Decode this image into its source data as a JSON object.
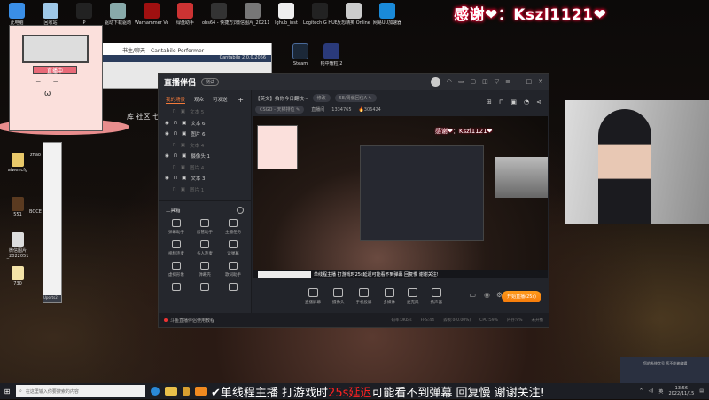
{
  "desktop": {
    "icons_top": [
      {
        "label": "此电脑",
        "color": "#3a8ee6"
      },
      {
        "label": "回收站",
        "color": "#9ec8e8"
      },
      {
        "label": "P",
        "color": "#222"
      },
      {
        "label": "驱动下载驱动",
        "color": "#8aa"
      },
      {
        "label": "Warhammer Vermintide",
        "color": "#a01010"
      },
      {
        "label": "绿盘助手",
        "color": "#c33"
      },
      {
        "label": "obs64 - 快捷方式",
        "color": "#333"
      },
      {
        "label": "微信图片_2021111",
        "color": "#777"
      },
      {
        "label": "lghub_inst",
        "color": "#eee"
      },
      {
        "label": "Logitech G HUB",
        "color": "#222"
      },
      {
        "label": "反恐精英 Online",
        "color": "#ccc"
      },
      {
        "label": "网易UU加速器",
        "color": "#1a8ad8"
      }
    ],
    "icons_second_row": [
      {
        "label": "Steam",
        "color": "#1b2838"
      },
      {
        "label": "帕中耀粒 2",
        "color": "#2a3a7a"
      }
    ],
    "icons_left": [
      {
        "label": "aiwencfg"
      },
      {
        "label": "zhao"
      },
      {
        "label": "551"
      },
      {
        "label": "BOCE"
      },
      {
        "label": "微信图片_2022051"
      },
      {
        "label": "730"
      }
    ],
    "left_window_footer": "Uports2",
    "partial_text": "库 社区 七"
  },
  "overlay": {
    "thanks": "感谢❤：Kszl1121❤",
    "pink_widget_tag": "直播中"
  },
  "cantabile": {
    "title": "书生/聊天 - Cantabile Performer",
    "version": "Cantabile 2.0.0.2066"
  },
  "app": {
    "logo": "直播伴侣",
    "version_badge": "测试",
    "title_icons": [
      "headset-icon",
      "message-icon",
      "screen-icon",
      "layers-icon",
      "shirt-icon",
      "menu-icon",
      "minimize-icon",
      "maximize-icon",
      "close-icon"
    ],
    "sidebar": {
      "tabs": [
        "我的场景",
        "观众",
        "可发送"
      ],
      "add": "+",
      "sources": [
        {
          "label": "文本 5",
          "visible": false
        },
        {
          "label": "文本 6",
          "visible": true
        },
        {
          "label": "图片 6",
          "visible": true
        },
        {
          "label": "文本 4",
          "visible": false
        },
        {
          "label": "摄像头 1",
          "visible": true
        },
        {
          "label": "图片 4",
          "visible": false
        },
        {
          "label": "文本 3",
          "visible": true
        },
        {
          "label": "图片 1",
          "visible": false
        }
      ],
      "toolbox_title": "工具箱",
      "tools": [
        "弹幕助手",
        "房管助手",
        "主播任务",
        "视频连麦",
        "多人连麦",
        "读弹幕",
        "虚拟形象",
        "弹幕壳",
        "歌词助手",
        "",
        "",
        ""
      ]
    },
    "header": {
      "title": "【英文】拍你今日翻快~",
      "edit_label": "修改",
      "notice": "5E/周偏回位A",
      "category": "CSGO - 天梯排位",
      "room_label": "直播间",
      "room_id": "1334765",
      "popularity": "306424"
    },
    "preview": {
      "thanks": "感谢❤：Kszl1121❤",
      "banner": "单线程主播 打游戏时25s延迟可能看不到弹幕 回复慢 谢谢关注!"
    },
    "controls": [
      "直播屏幕",
      "摄像头",
      "手机投屏",
      "多媒体",
      "麦克风",
      "扬声器"
    ],
    "go_live_label": "开始直播(25s)",
    "status": {
      "tutorial": "斗鱼直播伴侣使用教程",
      "bitrate": "码率:0Kb/s",
      "fps": "FPS:44",
      "dropped": "丢帧:0(0.00%)",
      "cpu": "CPU:59%",
      "memory": "内存:9%",
      "state": "未开播"
    }
  },
  "notification": {
    "text": "您的系统字号 您不能被编辑"
  },
  "taskbar": {
    "search_placeholder": "在这里输入你要搜索的内容",
    "banner_pre": "单线程主播 打游戏时",
    "banner_red": "25s延迟",
    "banner_post": "可能看不到弹幕 回复慢 谢谢关注!",
    "tray_lang": "英",
    "time": "13:56",
    "date": "2022/11/15"
  },
  "colors": {
    "accent": "#f47a3a",
    "go_live": "#f58a10",
    "thanks_glow": "#ff0033"
  }
}
